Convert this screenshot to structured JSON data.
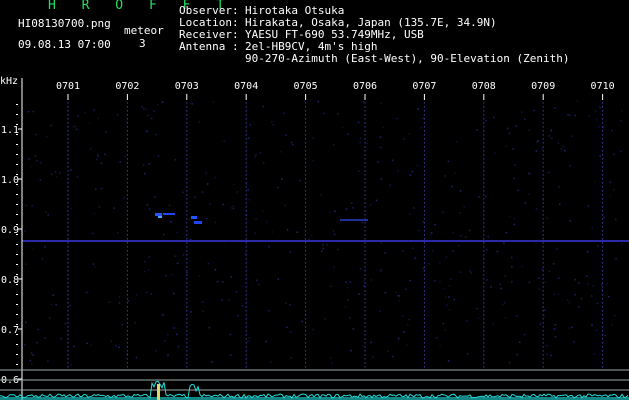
{
  "header": {
    "brand": "H R O F F T",
    "filename": "HI08130700.png",
    "meteor_label": "meteor",
    "meteor_count": "3",
    "datetime": "09.08.13 07:00"
  },
  "info": [
    {
      "key": "Observer",
      "value": "Hirotaka Otsuka"
    },
    {
      "key": "Location",
      "value": "Hirakata, Osaka, Japan (135.7E, 34.9N)"
    },
    {
      "key": "Receiver",
      "value": "YAESU FT-690 53.749MHz, USB"
    },
    {
      "key": "Antenna",
      "value": "2el-HB9CV, 4m's high"
    },
    {
      "key": "",
      "value": "90-270-Azimuth (East-West), 90-Elevation (Zenith)"
    }
  ],
  "spectrogram": {
    "y_unit": "kHz",
    "y_ticks": [
      "1.1",
      "1.0",
      "0.9",
      "0.8",
      "0.7",
      "0.6"
    ],
    "x_ticks": [
      "0701",
      "0702",
      "0703",
      "0704",
      "0705",
      "0706",
      "0707",
      "0708",
      "0709",
      "0710"
    ],
    "colors": {
      "axis": "#ffffff",
      "grid": "#3a3aa0",
      "signal": "#2244ff",
      "echo": "#33ccff",
      "baseline": "#22dddd"
    }
  }
}
